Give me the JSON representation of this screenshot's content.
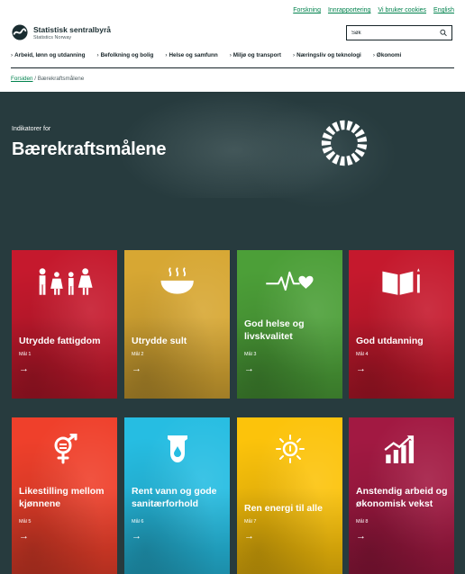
{
  "top_links": [
    "Forskning",
    "Innrapportering",
    "Vi bruker cookies",
    "English"
  ],
  "logo": {
    "name": "Statistisk sentralbyrå",
    "subtitle": "Statistics Norway"
  },
  "search": {
    "placeholder": "Søk"
  },
  "nav": [
    "Arbeid, lønn og utdanning",
    "Befolkning og bolig",
    "Helse og samfunn",
    "Miljø og transport",
    "Næringsliv og teknologi",
    "Økonomi"
  ],
  "breadcrumb": {
    "home": "Forsiden",
    "separator": "/",
    "current": "Bærekraftsmålene"
  },
  "hero": {
    "kicker": "Indikatorer for",
    "title": "Bærekraftsmålene"
  },
  "goals": [
    {
      "title": "Utrydde fattigdom",
      "goal": "Mål 1",
      "arrow": "→",
      "color": "#c5192d",
      "icon": "family-icon"
    },
    {
      "title": "Utrydde sult",
      "goal": "Mål 2",
      "arrow": "→",
      "color": "#d7a733",
      "icon": "bowl-icon"
    },
    {
      "title": "God helse og livskvalitet",
      "goal": "Mål 3",
      "arrow": "→",
      "color": "#4c9f38",
      "icon": "heartbeat-icon"
    },
    {
      "title": "God utdanning",
      "goal": "Mål 4",
      "arrow": "→",
      "color": "#c5192d",
      "icon": "book-icon"
    },
    {
      "title": "Likestilling mellom kjønnene",
      "goal": "Mål 5",
      "arrow": "→",
      "color": "#ef402b",
      "icon": "gender-icon"
    },
    {
      "title": "Rent vann og gode sanitærforhold",
      "goal": "Mål 6",
      "arrow": "→",
      "color": "#26bde2",
      "icon": "water-drop-icon"
    },
    {
      "title": "Ren energi til alle",
      "goal": "Mål 7",
      "arrow": "→",
      "color": "#fcc30b",
      "icon": "sun-power-icon"
    },
    {
      "title": "Anstendig arbeid og økonomisk vekst",
      "goal": "Mål 8",
      "arrow": "→",
      "color": "#a21942",
      "icon": "growth-chart-icon"
    }
  ]
}
